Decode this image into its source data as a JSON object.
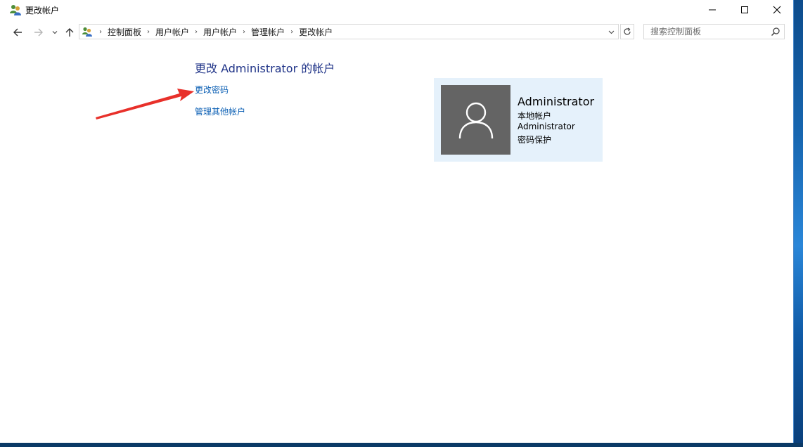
{
  "window": {
    "title": "更改帐户"
  },
  "navigation": {
    "breadcrumbs": [
      "控制面板",
      "用户帐户",
      "用户帐户",
      "管理帐户",
      "更改帐户"
    ],
    "search_placeholder": "搜索控制面板"
  },
  "main": {
    "heading": "更改 Administrator 的帐户",
    "links": {
      "change_password": "更改密码",
      "manage_other": "管理其他帐户"
    }
  },
  "account": {
    "name": "Administrator",
    "type": "本地帐户",
    "group": "Administrator",
    "status": "密码保护"
  },
  "colors": {
    "heading": "#1e3287",
    "link": "#0b5fb4",
    "card_bg": "#e5f1fb",
    "avatar_bg": "#646464",
    "annotation_arrow": "#e8302a"
  },
  "icons": {
    "app": "user-accounts-icon",
    "avatar": "user-silhouette-icon",
    "annotation": "red-arrow"
  }
}
